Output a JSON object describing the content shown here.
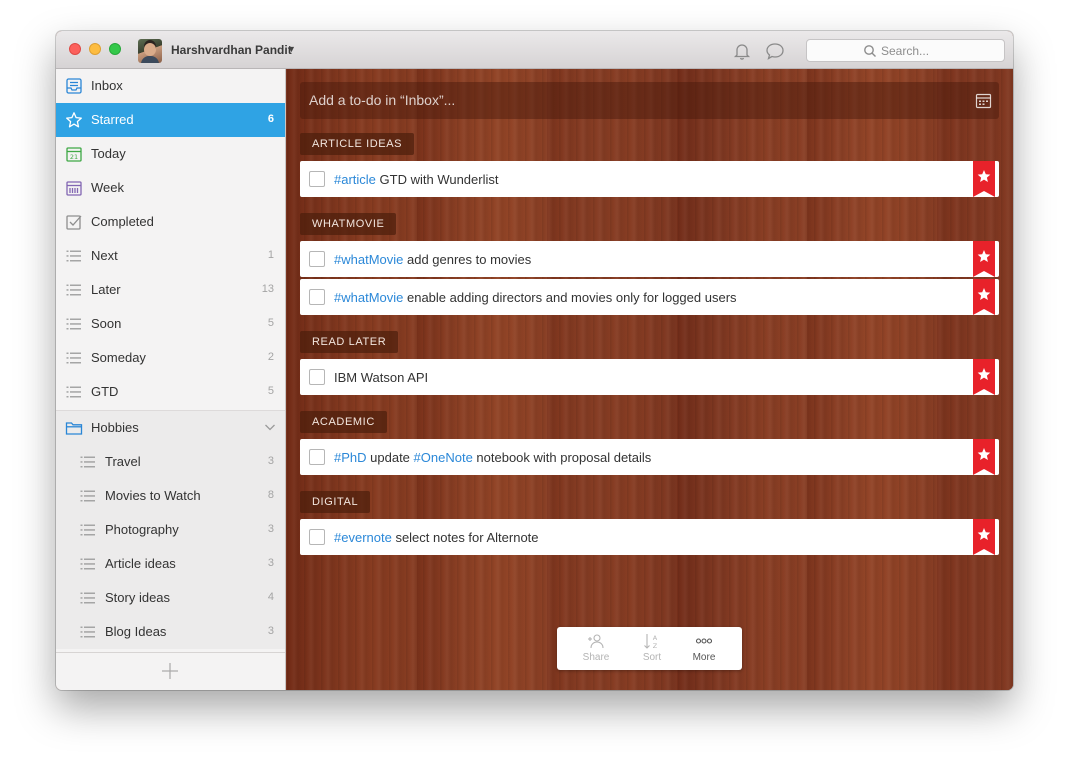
{
  "titlebar": {
    "username": "Harshvardhan Pandit",
    "search_placeholder": "Search..."
  },
  "sidebar": {
    "items": [
      {
        "label": "Inbox",
        "count": "",
        "icon": "inbox-icon"
      },
      {
        "label": "Starred",
        "count": "6",
        "icon": "star-icon"
      },
      {
        "label": "Today",
        "count": "",
        "icon": "calendar-today-icon"
      },
      {
        "label": "Week",
        "count": "",
        "icon": "calendar-week-icon"
      },
      {
        "label": "Completed",
        "count": "",
        "icon": "checkbox-icon"
      },
      {
        "label": "Next",
        "count": "1",
        "icon": "list-icon"
      },
      {
        "label": "Later",
        "count": "13",
        "icon": "list-icon"
      },
      {
        "label": "Soon",
        "count": "5",
        "icon": "list-icon"
      },
      {
        "label": "Someday",
        "count": "2",
        "icon": "list-icon"
      },
      {
        "label": "GTD",
        "count": "5",
        "icon": "list-icon"
      }
    ],
    "folder": {
      "label": "Hobbies",
      "icon": "folder-icon",
      "children": [
        {
          "label": "Travel",
          "count": "3"
        },
        {
          "label": "Movies to Watch",
          "count": "8"
        },
        {
          "label": "Photography",
          "count": "3"
        },
        {
          "label": "Article ideas",
          "count": "3"
        },
        {
          "label": "Story ideas",
          "count": "4"
        },
        {
          "label": "Blog Ideas",
          "count": "3"
        }
      ]
    }
  },
  "main": {
    "add_placeholder": "Add a to-do in “Inbox”...",
    "groups": [
      {
        "label": "ARTICLE IDEAS",
        "tasks": [
          {
            "tag": "#article",
            "text": " GTD with Wunderlist"
          }
        ]
      },
      {
        "label": "WHATMOVIE",
        "tasks": [
          {
            "tag": "#whatMovie",
            "text": " add genres to movies"
          },
          {
            "tag": "#whatMovie",
            "text": " enable adding directors and movies only for logged users"
          }
        ]
      },
      {
        "label": "READ LATER",
        "tasks": [
          {
            "tag": "",
            "text": "IBM Watson API"
          }
        ]
      },
      {
        "label": "ACADEMIC",
        "tasks": [
          {
            "tag": "#PhD",
            "text": " update ",
            "tag2": "#OneNote",
            "text2": " notebook with proposal details"
          }
        ]
      },
      {
        "label": "DIGITAL",
        "tasks": [
          {
            "tag": "#evernote",
            "text": " select notes for Alternote"
          }
        ]
      }
    ]
  },
  "toolbar": {
    "share_label": "Share",
    "sort_label": "Sort",
    "more_label": "More"
  },
  "colors": {
    "accent": "#2fa3e4",
    "tag": "#2b88d8",
    "flag": "#e8222a"
  }
}
